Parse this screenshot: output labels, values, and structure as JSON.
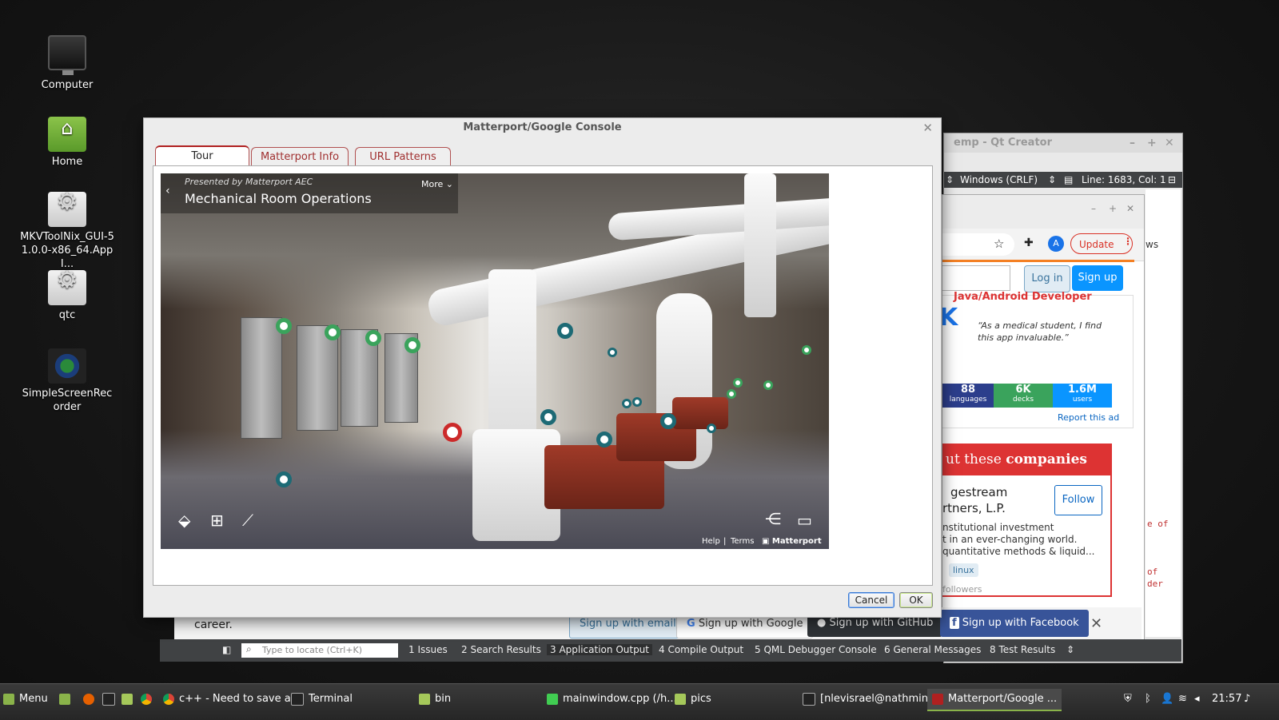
{
  "desktop": {
    "icons": [
      {
        "label": "Computer"
      },
      {
        "label": "Home"
      },
      {
        "label": "MKVToolNix_GUI-51.0.0-x86_64.AppI..."
      },
      {
        "label": "qtc"
      },
      {
        "label": "SimpleScreenRecorder"
      }
    ]
  },
  "qt_creator": {
    "title": "emp - Qt Creator",
    "encoding": "Windows (CRLF)",
    "position": "Line: 1683, Col: 1",
    "side_text": [
      "ws",
      "e of",
      "of",
      "der"
    ],
    "locator_placeholder": "Type to locate (Ctrl+K)",
    "output_tabs": [
      "1  Issues",
      "2  Search Results",
      "3  Application Output",
      "4  Compile Output",
      "5  QML Debugger Console",
      "6  General Messages",
      "8  Test Results"
    ]
  },
  "browser": {
    "update_label": "Update",
    "avatar_letter": "A",
    "login_label": "Log in",
    "signup_label": "Sign up",
    "ad_heading": "Java/Android Developer",
    "ad_quote": "“As a medical student, I find this app invaluable.”",
    "stats": [
      {
        "value": "88",
        "label": "languages"
      },
      {
        "value": "6K",
        "label": "decks"
      },
      {
        "value": "1.6M",
        "label": "users"
      }
    ],
    "report_label": "Report this ad",
    "companies_heading_plain": "ut these ",
    "companies_heading_bold": "companies",
    "company_name_1": "gestream",
    "company_name_2": "rtners, L.P.",
    "follow_label": "Follow",
    "company_desc_1": "nstitutional investment",
    "company_desc_2": "t in an ever-changing world.",
    "company_desc_3": "quantitative methods & liquid...",
    "company_tag": "linux",
    "followers": "followers"
  },
  "signup_bar": {
    "career": "career.",
    "email_label": "Sign up with email",
    "google_label": "Sign up with Google",
    "github_label": "Sign up with GitHub",
    "facebook_label": "Sign up with Facebook",
    "close_label": "✕"
  },
  "dialog": {
    "title": "Matterport/Google Console",
    "close_label": "✕",
    "tabs": [
      "Tour",
      "Matterport Info",
      "URL Patterns"
    ],
    "active_tab": 0,
    "cancel_label": "Cancel",
    "ok_label": "OK"
  },
  "tour": {
    "presented_by": "Presented by Matterport AEC",
    "title": "Mechanical Room Operations",
    "more_label": "More ⌄",
    "back_label": "‹",
    "footer_help": "Help",
    "footer_sep": "|",
    "footer_terms": "Terms",
    "footer_brand": "▣ Matterport",
    "tools": [
      "dollhouse-icon",
      "floorplan-icon",
      "measure-icon",
      "share-icon",
      "vr-icon"
    ]
  },
  "taskbar": {
    "menu_label": "Menu",
    "items": [
      {
        "label": "c++ - Need to save a..."
      },
      {
        "label": "Terminal"
      },
      {
        "label": "bin"
      },
      {
        "label": "mainwindow.cpp (/h..."
      },
      {
        "label": "pics"
      },
      {
        "label": "[nlevisrael@nathmin..."
      },
      {
        "label": "Matterport/Google ..."
      }
    ],
    "clock": "21:57"
  },
  "colors": {
    "accent_red": "#b02020",
    "stack_orange": "#f48024",
    "stack_blue": "#0a95ff",
    "facebook_blue": "#385499",
    "github_dark": "#2f3337",
    "mint_green": "#8ab34a"
  }
}
